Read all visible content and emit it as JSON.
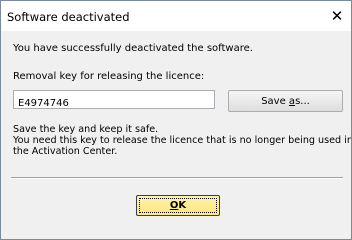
{
  "dialog": {
    "title": "Software deactivated",
    "close_glyph": "✕",
    "message": "You have successfully deactivated the software.",
    "key_label": "Removal key for releasing the licence:",
    "key_value": "E4974746",
    "save_as_button": {
      "before": "Save ",
      "accel": "a",
      "after": "s..."
    },
    "note_lines": [
      "Save the key and keep it safe.",
      "You need this key to release the licence that is no longer being used in",
      "the Activation Center."
    ],
    "ok_button": {
      "accel": "O",
      "after": "K"
    }
  },
  "icons": {
    "close": "close-icon"
  },
  "colors": {
    "ok_button_fill": "#ffe680",
    "dialog_background": "#f0f0f0"
  }
}
